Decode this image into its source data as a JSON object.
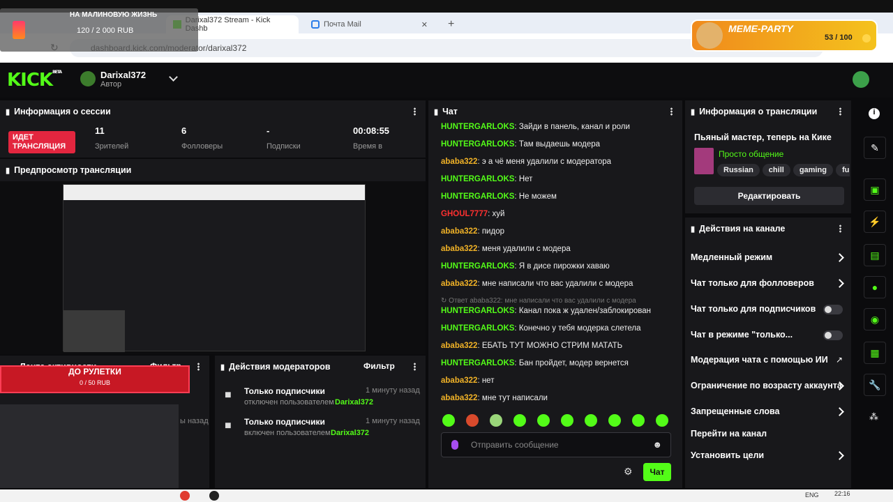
{
  "overlay": {
    "donation_title": "НА МАЛИНОВУЮ ЖИЗНЬ",
    "donation_progress": "120 / 2 000 RUB",
    "meme_party_title": "MEME-PARTY",
    "meme_party_progress": "53 / 100",
    "roulette_title": "ДО РУЛЕТКИ",
    "roulette_progress": "0 / 50 RUB"
  },
  "browser": {
    "tabs": [
      {
        "label": "Darixal372 Stream - Kick Dashb"
      },
      {
        "label": "Почта Mail"
      }
    ],
    "url": "dashboard.kick.com/moderator/darixal372",
    "clock": "22:16",
    "lang": "ENG"
  },
  "header": {
    "logo": "KICK",
    "beta": "BETA",
    "username": "Darixal372",
    "role": "Автор"
  },
  "session": {
    "title": "Информация о сессии",
    "live_badge": "ИДЕТ ТРАНСЛЯЦИЯ",
    "viewers": "11",
    "viewers_label": "Зрителей",
    "followers": "6",
    "followers_label": "Фолловеры",
    "subs": "-",
    "subs_label": "Подписки",
    "time": "00:08:55",
    "time_label": "Время в"
  },
  "preview": {
    "title": "Предпросмотр трансляции"
  },
  "activity": {
    "title": "Лента активности",
    "filter": "Фильтр",
    "time_prefix": "ы назад"
  },
  "mod_actions": {
    "title": "Действия модераторов",
    "filter": "Фильтр",
    "items": [
      {
        "title": "Только подписчики",
        "time": "1 минуту назад",
        "desc": "отключен пользователем",
        "user": "Darixal372"
      },
      {
        "title": "Только подписчики",
        "time": "1 минуту назад",
        "desc": "включен пользователем",
        "user": "Darixal372"
      }
    ]
  },
  "chat": {
    "title": "Чат",
    "messages": [
      {
        "user": "HUNTERGARLOKS",
        "color": "green",
        "text": "Зайди в панель, канал и роли"
      },
      {
        "user": "HUNTERGARLOKS",
        "color": "green",
        "text": "Там выдаешь модера"
      },
      {
        "user": "ababa322",
        "color": "gold",
        "text": "э а чё меня удалили с модератора"
      },
      {
        "user": "HUNTERGARLOKS",
        "color": "green",
        "text": "Нет"
      },
      {
        "user": "HUNTERGARLOKS",
        "color": "green",
        "text": "Не можем"
      },
      {
        "user": "GHOUL7777",
        "color": "red",
        "text": "хуй"
      },
      {
        "user": "ababa322",
        "color": "gold",
        "text": "пидор"
      },
      {
        "user": "ababa322",
        "color": "gold",
        "text": "меня удалили с модера"
      },
      {
        "user": "HUNTERGARLOKS",
        "color": "green",
        "text": "Я в дисе пирожки хаваю"
      },
      {
        "user": "ababa322",
        "color": "gold",
        "text": "мне написали что вас удалили с модера"
      },
      {
        "user": "HUNTERGARLOKS",
        "color": "green",
        "text": "Канал пока ж удален/заблокирован"
      },
      {
        "user": "HUNTERGARLOKS",
        "color": "green",
        "text": "Конечно у тебя модерка слетела"
      },
      {
        "user": "ababa322",
        "color": "gold",
        "text": "ЕБАТЬ ТУТ МОЖНО СТРИМ МАТАТЬ"
      },
      {
        "user": "HUNTERGARLOKS",
        "color": "green",
        "text": "Бан пройдет, модер вернется"
      },
      {
        "user": "ababa322",
        "color": "gold",
        "text": "нет"
      },
      {
        "user": "ababa322",
        "color": "gold",
        "text": "мне тут написали"
      }
    ],
    "reply_note": "Ответ ababa322: мне написали что вас удалили с модера",
    "input_placeholder": "Отправить сообщение",
    "send_label": "Чат"
  },
  "stream_info": {
    "title": "Информация о трансляции",
    "stream_title": "Пьяный мастер, теперь на Кике",
    "category": "Просто общение",
    "tags": [
      "Russian",
      "chill",
      "gaming",
      "funn"
    ],
    "edit_label": "Редактировать"
  },
  "channel_actions": {
    "title": "Действия на канале",
    "items": [
      {
        "label": "Медленный режим",
        "kind": "chevron"
      },
      {
        "label": "Чат только для фолловеров",
        "kind": "chevron"
      },
      {
        "label": "Чат только для подписчиков",
        "kind": "toggle"
      },
      {
        "label": "Чат в режиме \"только...",
        "kind": "toggle"
      },
      {
        "label": "Модерация чата с помощью ИИ",
        "kind": "external"
      },
      {
        "label": "Ограничение по возрасту аккаунта",
        "kind": "chevron"
      },
      {
        "label": "Запрещенные слова",
        "kind": "chevron"
      },
      {
        "label": "Перейти на канал",
        "kind": "none"
      },
      {
        "label": "Установить цели",
        "kind": "chevron"
      }
    ]
  },
  "colors": {
    "accent": "#53fc18",
    "gold": "#f2b327",
    "red": "#ff3030",
    "live": "#e3263f"
  }
}
